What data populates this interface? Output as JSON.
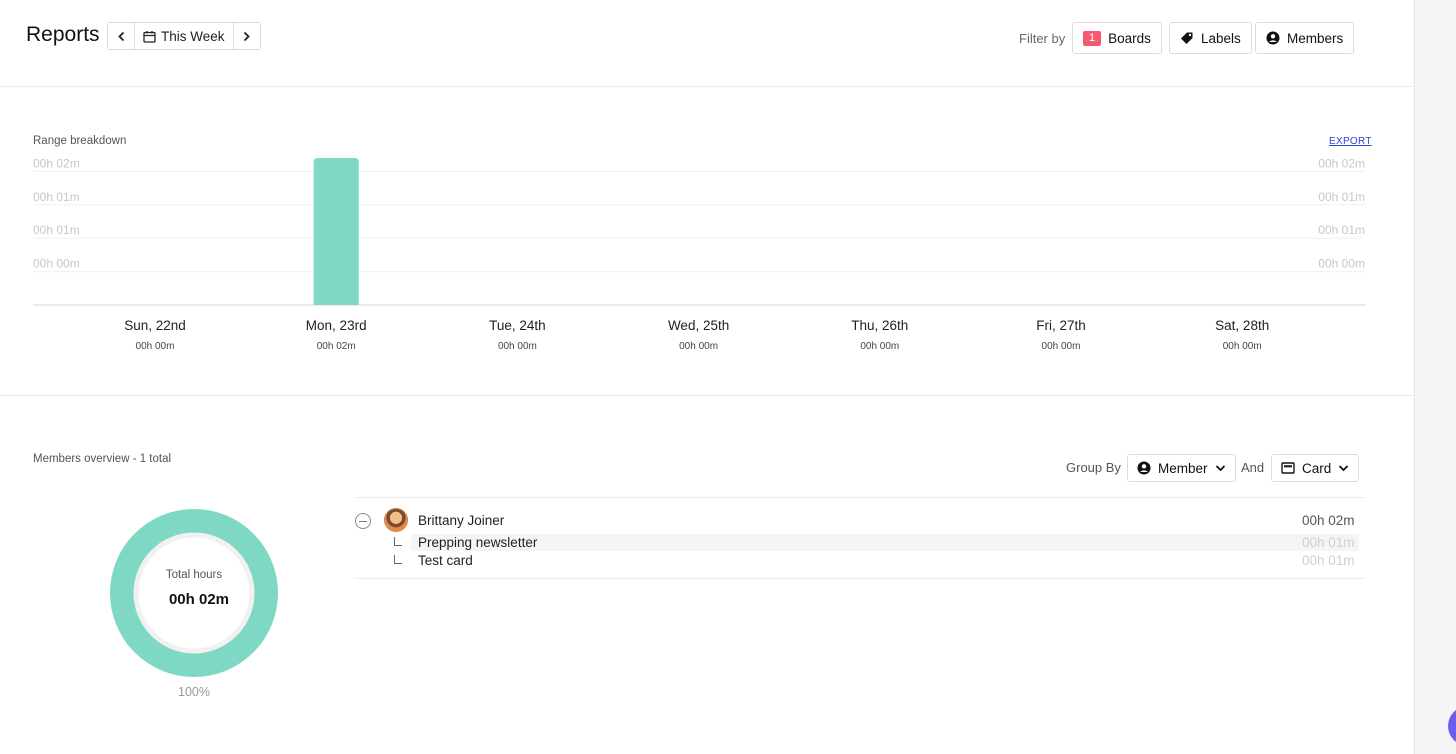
{
  "header": {
    "title": "Reports",
    "range_label": "This Week",
    "filter_label": "Filter by",
    "filters": [
      {
        "label": "Boards",
        "badge": "1"
      },
      {
        "label": "Labels"
      },
      {
        "label": "Members"
      }
    ]
  },
  "range_breakdown": {
    "label": "Range breakdown",
    "export_label": "EXPORT"
  },
  "chart_data": {
    "type": "bar",
    "title": "Range breakdown",
    "categories": [
      "Sun, 22nd",
      "Mon, 23rd",
      "Tue, 24th",
      "Wed, 25th",
      "Thu, 26th",
      "Fri, 27th",
      "Sat, 28th"
    ],
    "category_totals": [
      "00h 00m",
      "00h 02m",
      "00h 00m",
      "00h 00m",
      "00h 00m",
      "00h 00m",
      "00h 00m"
    ],
    "values_minutes": [
      0,
      2.2,
      0,
      0,
      0,
      0,
      0
    ],
    "y_ticks": [
      "00h 02m",
      "00h 01m",
      "00h 01m",
      "00h 00m"
    ],
    "y_tick_values_minutes": [
      2,
      1.5,
      1,
      0.5
    ],
    "ylim": [
      0,
      2.2
    ],
    "bar_color": "#7fd8c3",
    "grid": true
  },
  "members_overview": {
    "label": "Members overview - 1 total",
    "group_by_label": "Group By",
    "group_by_value": "Member",
    "and_label": "And",
    "and_value": "Card",
    "donut": {
      "center_label": "Total hours",
      "center_value": "00h 02m",
      "percent": "100%",
      "fraction": 1.0,
      "color": "#7fd8c3"
    },
    "member": {
      "name": "Brittany Joiner",
      "total": "00h 02m",
      "cards": [
        {
          "name": "Prepping newsletter",
          "time": "00h 01m"
        },
        {
          "name": "Test card",
          "time": "00h 01m"
        }
      ]
    }
  }
}
